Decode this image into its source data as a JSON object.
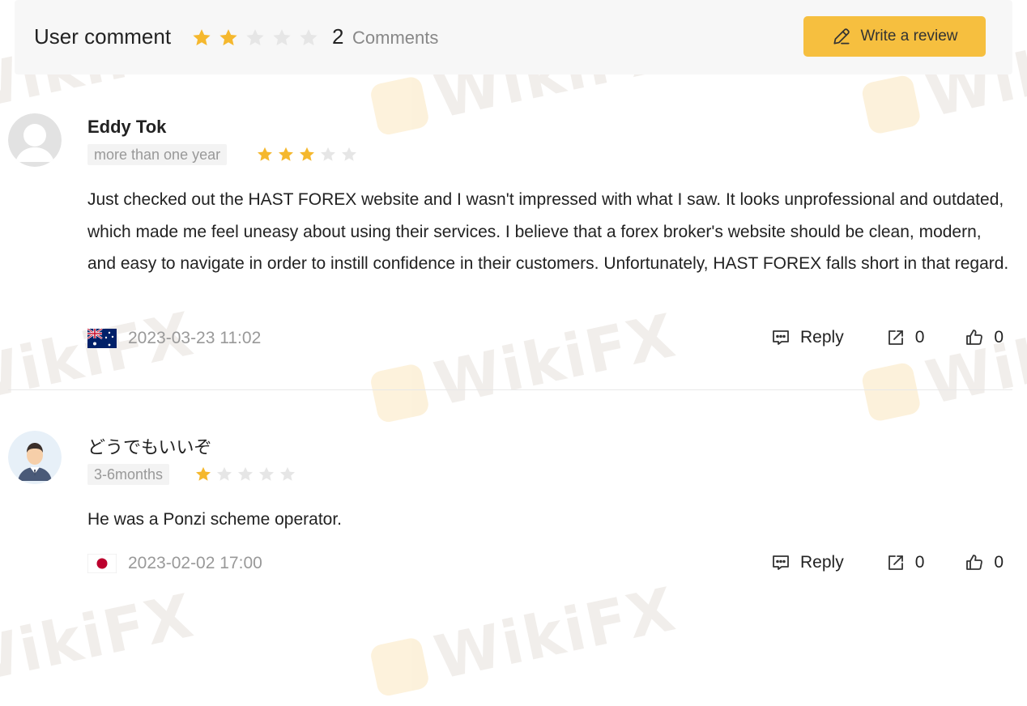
{
  "header": {
    "title": "User comment",
    "rating_stars_filled": 2,
    "rating_stars_total": 5,
    "comment_count": "2",
    "comment_label": "Comments",
    "write_review_label": "Write a review"
  },
  "watermark": "WikiFX",
  "colors": {
    "star_filled": "#f5b82e",
    "star_empty": "#e6e6e6",
    "button_bg": "#f6bf3f",
    "muted_text": "#999999"
  },
  "reviews": [
    {
      "name": "Eddy Tok",
      "avatar": "default-user-silhouette",
      "duration": "more than one year",
      "stars_filled": 3,
      "stars_total": 5,
      "text": "Just checked out the HAST FOREX website and I wasn't impressed with what I saw. It looks unprofessional and outdated, which made me feel uneasy about using their services. I believe that a forex broker's website should be clean, modern, and easy to navigate in order to instill confidence in their customers. Unfortunately, HAST FOREX falls short in that regard.",
      "flag": "australia-flag",
      "date": "2023-03-23 11:02",
      "reply_label": "Reply",
      "share_count": "0",
      "like_count": "0"
    },
    {
      "name": "どうでもいいぞ",
      "avatar": "man-in-suit-avatar",
      "duration": "3-6months",
      "stars_filled": 1,
      "stars_total": 5,
      "text": "He was a Ponzi scheme operator.",
      "flag": "japan-flag",
      "date": "2023-02-02 17:00",
      "reply_label": "Reply",
      "share_count": "0",
      "like_count": "0"
    }
  ]
}
